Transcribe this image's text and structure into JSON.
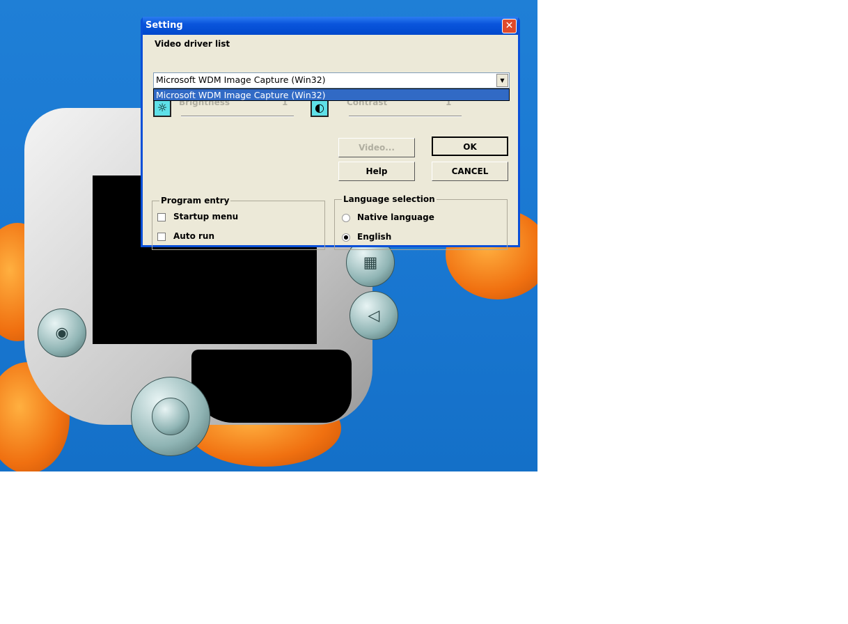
{
  "dialog": {
    "title": "Setting",
    "close_label": "✕",
    "video_driver_label": "Video driver list",
    "video_driver_selected": "Microsoft WDM Image Capture (Win32)",
    "video_driver_options": [
      "Microsoft WDM Image Capture (Win32)"
    ],
    "brightness": {
      "label": "Brightness",
      "value": "1"
    },
    "contrast": {
      "label": "Contrast",
      "value": "1"
    },
    "buttons": {
      "video": "Video...",
      "ok": "OK",
      "help": "Help",
      "cancel": "CANCEL"
    },
    "program_entry": {
      "label": "Program entry",
      "items": [
        {
          "label": "Startup menu",
          "checked": false
        },
        {
          "label": "Auto run",
          "checked": false
        }
      ]
    },
    "language": {
      "label": "Language selection",
      "options": [
        {
          "label": "Native language",
          "selected": false
        },
        {
          "label": "English",
          "selected": true
        }
      ]
    }
  },
  "colors": {
    "titlebar": "#0a55dc",
    "selection": "#316ac5",
    "dialog_bg": "#ece9d8",
    "desktop": "#1a78d2"
  }
}
